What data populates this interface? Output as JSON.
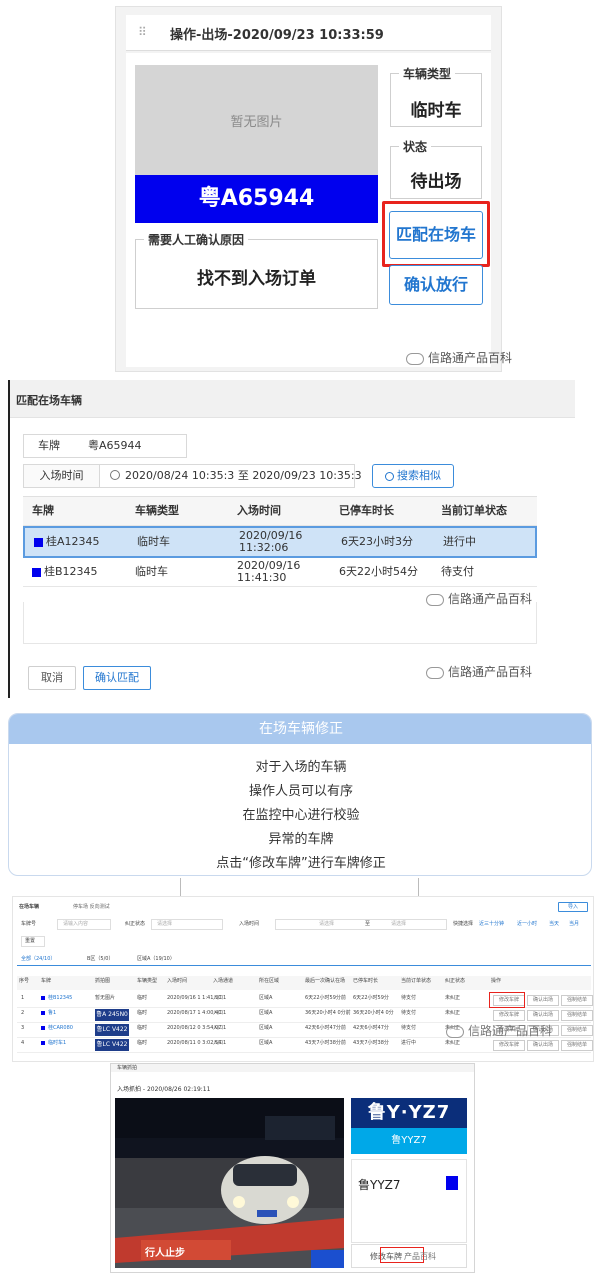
{
  "operation": {
    "title": "操作-出场-2020/09/23 10:33:59",
    "no_photo": "暂无图片",
    "plate": "粤A65944",
    "reason_label": "需要人工确认原因",
    "reason_value": "找不到入场订单",
    "vehicle_type_label": "车辆类型",
    "vehicle_type_value": "临时车",
    "status_label": "状态",
    "status_value": "待出场",
    "match_button": "匹配在场车",
    "confirm_release_button": "确认放行",
    "watermark": "信路通产品百科"
  },
  "match_dialog": {
    "title": "匹配在场车辆",
    "plate_label": "车牌",
    "plate_value": "粤A65944",
    "time_label": "入场时间",
    "time_start": "2020/08/24 10:35:3",
    "time_sep": "至",
    "time_end": "2020/09/23 10:35:3",
    "search_button": "搜索相似",
    "columns": [
      "车牌",
      "车辆类型",
      "入场时间",
      "已停车时长",
      "当前订单状态"
    ],
    "rows": [
      {
        "plate": "桂A12345",
        "type": "临时车",
        "time": "2020/09/16 11:32:06",
        "duration": "6天23小时3分",
        "status": "进行中",
        "selected": true
      },
      {
        "plate": "桂B12345",
        "type": "临时车",
        "time": "2020/09/16 11:41:30",
        "duration": "6天22小时54分",
        "status": "待支付",
        "selected": false
      }
    ],
    "cancel_button": "取消",
    "confirm_button": "确认匹配",
    "watermark": "信路通产品百科"
  },
  "info": {
    "title": "在场车辆修正",
    "lines": [
      "对于入场的车辆",
      "操作人员可以有序",
      "在监控中心进行校验",
      "异常的车牌",
      "点击“修改车牌”进行车牌修正"
    ]
  },
  "lot": {
    "title": "在场车辆",
    "location": "停车场  反向测试",
    "export": "导入",
    "plate_filter": "车牌号",
    "plate_placeholder": "请输入内容",
    "correct_status": "纠正状态",
    "select_placeholder": "请选择",
    "time_filter": "入场时间",
    "to": "至",
    "quick_select": "快捷选择",
    "quick_options": [
      "近三十分钟",
      "近一小时",
      "当天",
      "当月"
    ],
    "reset": "重置",
    "tabs": [
      "全部（24/10）",
      "B区（5/0）",
      "区域A（19/10）"
    ],
    "columns": [
      "序号",
      "车牌",
      "抓拍图",
      "车辆类型",
      "入场时间",
      "入场通道",
      "所在区域",
      "最后一次确认在场",
      "已停车时长",
      "当前订单状态",
      "纠正状态",
      "操作"
    ],
    "rows": [
      {
        "no": "1",
        "plate": "桂B12345",
        "img": "暂无图片",
        "type": "临时",
        "time": "2020/09/16 1 1:41:30",
        "gate": "入口1",
        "area": "区域A",
        "last": "6天22小时59分前",
        "duration": "6天22小时59分",
        "order": "待支付",
        "correct": "未纠正"
      },
      {
        "no": "2",
        "plate": "鲁1",
        "img": "鲁A 245N0",
        "type": "临时",
        "time": "2020/08/17 1 4:00:40",
        "gate": "入口1",
        "area": "区域A",
        "last": "36天20小时4 0分前",
        "duration": "36天20小时4 0分",
        "order": "待支付",
        "correct": "未纠正"
      },
      {
        "no": "3",
        "plate": "桂CAR080",
        "img": "鲁LC V422",
        "type": "临时",
        "time": "2020/08/12 0 3:54:07",
        "gate": "入口1",
        "area": "区域A",
        "last": "42天6小时47分前",
        "duration": "42天6小时47分",
        "order": "待支付",
        "correct": "未纠正"
      },
      {
        "no": "4",
        "plate": "临时车1",
        "img": "鲁LC V422",
        "type": "临时",
        "time": "2020/08/11 0 3:02:54",
        "gate": "入口1",
        "area": "区域A",
        "last": "43天7小时38分前",
        "duration": "43天7小时38分",
        "order": "进行中",
        "correct": "未纠正"
      }
    ],
    "actions": [
      "修改车牌",
      "确认出场",
      "强制结单"
    ],
    "watermark": "信路通产品百科"
  },
  "capture": {
    "top_title": "车辆抓拍",
    "title": "入场抓拍 - 2020/08/26 02:19:11",
    "plate_image_text": "鲁Y·YZ7",
    "plate_blue_text": "鲁YYZ7",
    "plate_text": "鲁YYZ7",
    "sign_text": "行人止步",
    "button_label": "修改车牌",
    "watermark": "产品百科"
  }
}
